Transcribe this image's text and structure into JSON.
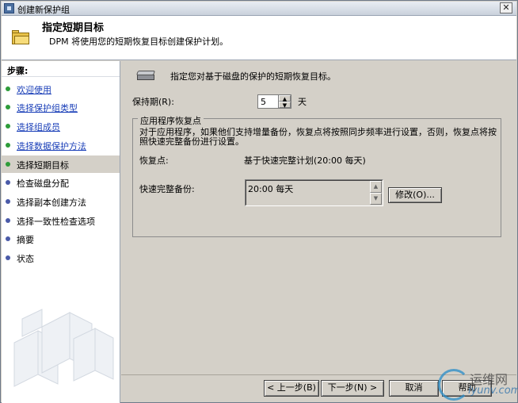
{
  "window": {
    "title": "创建新保护组",
    "close_glyph": "✕"
  },
  "header": {
    "title": "指定短期目标",
    "subtitle": "DPM 将使用您的短期恢复目标创建保护计划。"
  },
  "sidebar": {
    "title": "步骤:",
    "items": [
      {
        "label": "欢迎使用",
        "state": "done"
      },
      {
        "label": "选择保护组类型",
        "state": "done"
      },
      {
        "label": "选择组成员",
        "state": "done"
      },
      {
        "label": "选择数据保护方法",
        "state": "done"
      },
      {
        "label": "选择短期目标",
        "state": "current"
      },
      {
        "label": "检查磁盘分配",
        "state": "pending"
      },
      {
        "label": "选择副本创建方法",
        "state": "pending"
      },
      {
        "label": "选择一致性检查选项",
        "state": "pending"
      },
      {
        "label": "摘要",
        "state": "pending"
      },
      {
        "label": "状态",
        "state": "pending"
      }
    ]
  },
  "main": {
    "intro": "指定您对基于磁盘的保护的短期恢复目标。",
    "retention": {
      "label": "保持期(R):",
      "value": "5",
      "unit": "天"
    },
    "app_recovery": {
      "legend": "应用程序恢复点",
      "description": "对于应用程序，如果他们支持增量备份，恢复点将按照同步频率进行设置，否则，恢复点将按照快速完整备份进行设置。",
      "recovery_points_label": "恢复点:",
      "recovery_points_value": "基于快速完整计划(20:00 每天)",
      "fast_full_backup_label": "快速完整备份:",
      "fast_full_backup_items": [
        "20:00 每天"
      ],
      "modify_label": "修改(O)..."
    }
  },
  "footer": {
    "back_label": "< 上一步(B)",
    "next_label": "下一步(N) >",
    "cancel_label": "取消",
    "help_label": "帮助"
  },
  "watermark": {
    "cn": "运维网",
    "en": "iyunv.com"
  },
  "colors": {
    "done_dot": "#2e9c3a",
    "pending_dot": "#4a5aa8",
    "link": "#1a3fb8",
    "dialog_bg": "#d4d0c8"
  }
}
